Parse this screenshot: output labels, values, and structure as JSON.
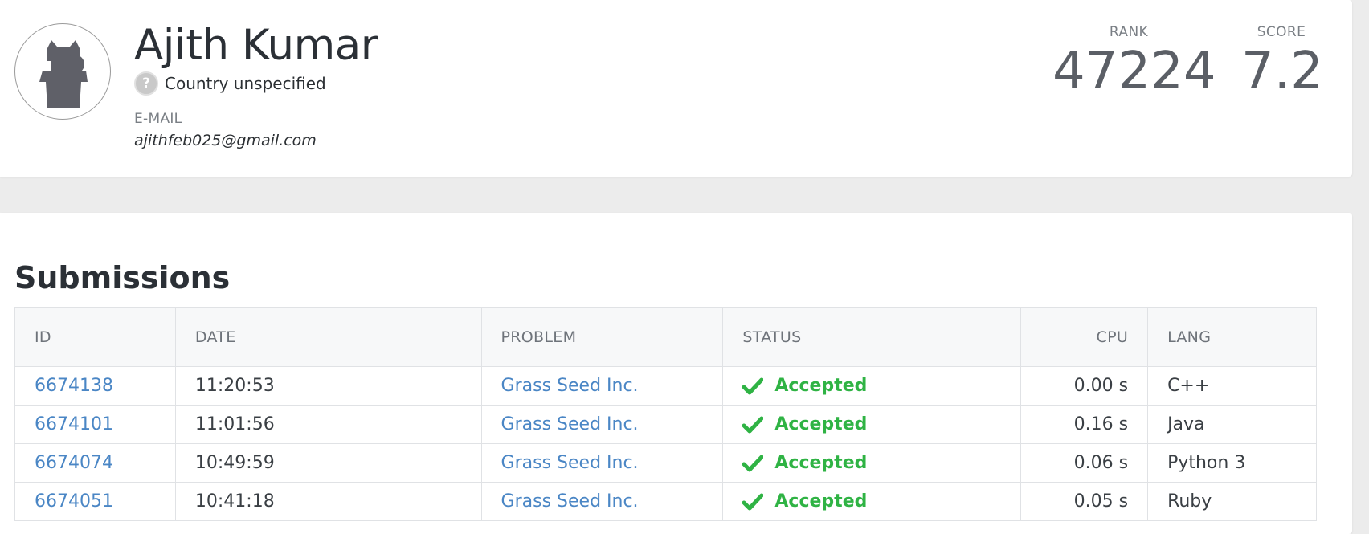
{
  "profile": {
    "name": "Ajith Kumar",
    "country": "Country unspecified",
    "country_icon": "question-mark-icon",
    "email_label": "E-MAIL",
    "email": "ajithfeb025@gmail.com",
    "avatar_icon": "cat-silhouette-avatar-icon"
  },
  "stats": {
    "rank_label": "RANK",
    "rank_value": "47224",
    "score_label": "SCORE",
    "score_value": "7.2"
  },
  "submissions": {
    "title": "Submissions",
    "columns": {
      "id": "ID",
      "date": "DATE",
      "problem": "PROBLEM",
      "status": "STATUS",
      "cpu": "CPU",
      "lang": "LANG"
    },
    "rows": [
      {
        "id": "6674138",
        "date": "11:20:53",
        "problem": "Grass Seed Inc.",
        "status": "Accepted",
        "cpu": "0.00 s",
        "lang": "C++"
      },
      {
        "id": "6674101",
        "date": "11:01:56",
        "problem": "Grass Seed Inc.",
        "status": "Accepted",
        "cpu": "0.16 s",
        "lang": "Java"
      },
      {
        "id": "6674074",
        "date": "10:49:59",
        "problem": "Grass Seed Inc.",
        "status": "Accepted",
        "cpu": "0.06 s",
        "lang": "Python 3"
      },
      {
        "id": "6674051",
        "date": "10:41:18",
        "problem": "Grass Seed Inc.",
        "status": "Accepted",
        "cpu": "0.05 s",
        "lang": "Ruby"
      }
    ]
  },
  "colors": {
    "link": "#4a86c5",
    "accepted": "#2fb344",
    "page_background": "#ececec"
  }
}
